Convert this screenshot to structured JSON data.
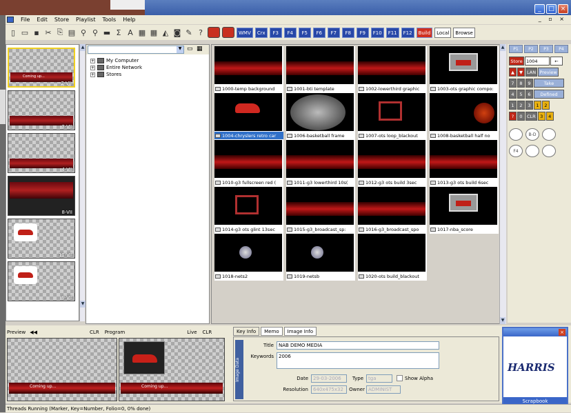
{
  "menu": [
    "File",
    "Edit",
    "Store",
    "Playlist",
    "Tools",
    "Help"
  ],
  "toolbar": {
    "fkeys": [
      "WMV",
      "Crx",
      "F3",
      "F4",
      "F5",
      "F6",
      "F7",
      "F8",
      "F9",
      "F10",
      "F11",
      "F12"
    ],
    "build": "Build",
    "local": "Local",
    "browse": "Browse"
  },
  "left_thumbs": [
    {
      "label": "2-VII",
      "caption": "Coming up..."
    },
    {
      "label": "3-VII",
      "caption": ""
    },
    {
      "label": "4-VII",
      "caption": ""
    },
    {
      "label": "8-VII",
      "caption": ""
    },
    {
      "label": "11-VII",
      "caption": ""
    },
    {
      "label": "9-VII",
      "caption": ""
    }
  ],
  "tree": [
    "My Computer",
    "Entire Network",
    "Stores"
  ],
  "grid": [
    {
      "caption": "1000-temp background",
      "art": "band"
    },
    {
      "caption": "1001-bti template",
      "art": "band"
    },
    {
      "caption": "1002-lowerthird graphic",
      "art": "band"
    },
    {
      "caption": "1003-ots graphic compo:",
      "art": "tv"
    },
    {
      "caption": "1004-chryslers retro car",
      "art": "car",
      "selected": true
    },
    {
      "caption": "1006-basketball frame",
      "art": "ball"
    },
    {
      "caption": "1007-ots loop_blackout",
      "art": "frame"
    },
    {
      "caption": "1008-basketball half no",
      "art": "ballr"
    },
    {
      "caption": "1010-g3 fullscreen red (",
      "art": "band"
    },
    {
      "caption": "1011-g3 lowerthird 10s(",
      "art": "band"
    },
    {
      "caption": "1012-g3 ots build 3sec",
      "art": "band"
    },
    {
      "caption": "1013-g3 ots build 6sec",
      "art": "band"
    },
    {
      "caption": "1014-g3 ots glint 13sec",
      "art": "frame"
    },
    {
      "caption": "1015-g3_broadcast_sp:",
      "art": "band"
    },
    {
      "caption": "1016-g3_broadcast_spo",
      "art": "band"
    },
    {
      "caption": "1017-nba_score",
      "art": "tv"
    },
    {
      "caption": "1018-nets2",
      "art": "orb"
    },
    {
      "caption": "1019-netsb",
      "art": "orb"
    },
    {
      "caption": "1020-ots build_blackout",
      "art": "none"
    }
  ],
  "keypad": {
    "tabs": [
      "P1",
      "P2",
      "P3",
      "P4"
    ],
    "store_label": "Store",
    "store_value": "1004",
    "row1": [
      "▲",
      "▼",
      "LAN",
      "Preview"
    ],
    "row2": [
      "7",
      "8",
      "9",
      "Take"
    ],
    "row3": [
      "4",
      "5",
      "6",
      "Defined"
    ],
    "row4": [
      "1",
      "2",
      "3",
      "1",
      "2"
    ],
    "row5": [
      "?",
      "0",
      "CLR",
      "3",
      "4"
    ],
    "circles": [
      "",
      "B-D",
      "",
      "F4",
      "",
      ""
    ]
  },
  "preview": {
    "preview_label": "Preview",
    "clr": "CLR",
    "program": "Program",
    "live": "Live",
    "clr2": "CLR",
    "coming_up": "Coming up..."
  },
  "info": {
    "tabs": [
      "Key Info",
      "Memo",
      "Image Info"
    ],
    "side_label": "Image Data",
    "title_label": "Title",
    "title_value": "NAB DEMO MEDIA",
    "keywords_label": "Keywords",
    "keywords_value": "2006",
    "date_label": "Date",
    "date_value": "29-03-2006",
    "type_label": "Type",
    "type_value": "tga",
    "show_alpha": "Show Alpha",
    "resolution_label": "Resolution",
    "resolution_value": "640x475x32",
    "owner_label": "Owner",
    "owner_value": "ADMINIST"
  },
  "harris": {
    "logo": "HARRIS",
    "footer": "Scrapbook"
  },
  "status": "Threads Running (Marker, Key=Number, Folio=0, 0% done)"
}
